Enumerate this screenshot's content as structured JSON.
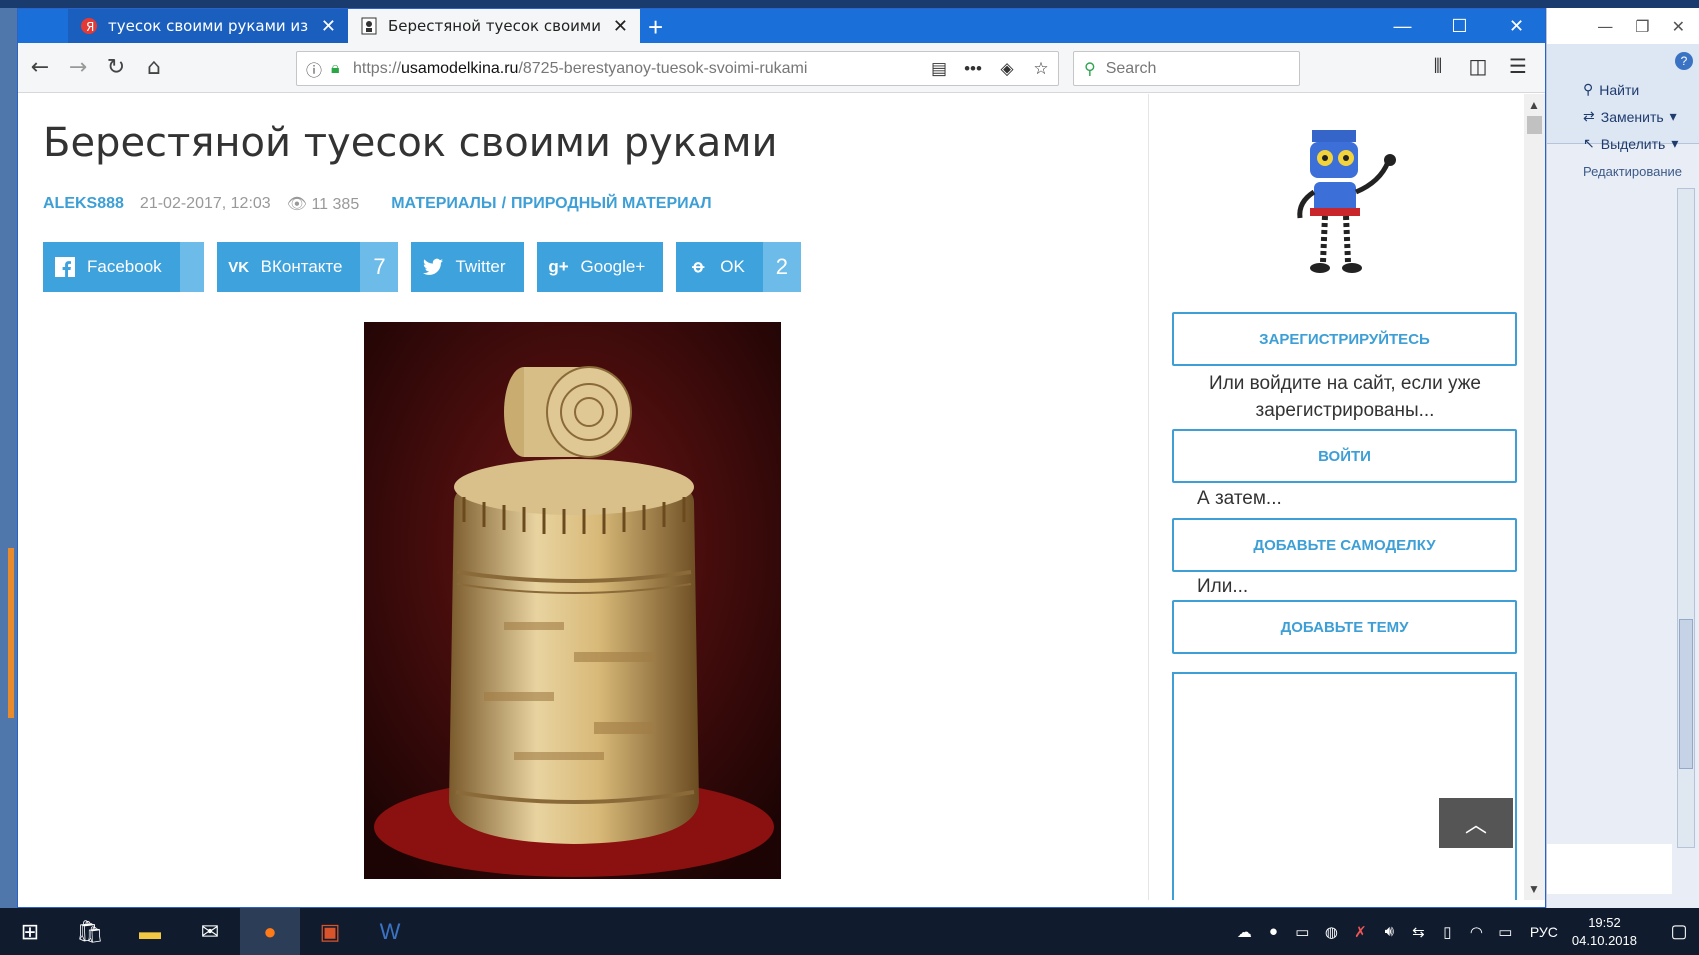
{
  "browser": {
    "tabs": [
      {
        "title": "туесок своими руками из бер",
        "state": "inactive"
      },
      {
        "title": "Берестяной туесок своими ру",
        "state": "active"
      }
    ],
    "url": {
      "prefix": "https://",
      "domain": "usamodelkina.ru",
      "path": "/8725-berestyanoy-tuesok-svoimi-rukami"
    },
    "search_placeholder": "Search"
  },
  "article": {
    "title": "Берестяной туесок своими руками",
    "author": "ALEKS888",
    "date": "21-02-2017, 12:03",
    "views": "11 385",
    "category1": "МАТЕРИАЛЫ",
    "category_sep": "/",
    "category2": "ПРИРОДНЫЙ МАТЕРИАЛ",
    "share": [
      {
        "label": "Facebook",
        "count": "",
        "icon": "facebook-icon"
      },
      {
        "label": "ВКонтакте",
        "count": "7",
        "icon": "vk-icon"
      },
      {
        "label": "Twitter",
        "count": "",
        "icon": "twitter-icon"
      },
      {
        "label": "Google+",
        "count": "",
        "icon": "googleplus-icon"
      },
      {
        "label": "OK",
        "count": "2",
        "icon": "ok-icon"
      }
    ]
  },
  "sidebar": {
    "register": "ЗАРЕГИСТРИРУЙТЕСЬ",
    "or_login_text": "Или войдите на сайт, если уже зарегистрированы...",
    "login": "ВОЙТИ",
    "then_text": "А затем...",
    "add_craft": "ДОБАВЬТЕ САМОДЕЛКУ",
    "or_text": "Или...",
    "add_topic": "ДОБАВЬТЕ ТЕМУ"
  },
  "word": {
    "find": "Найти",
    "replace": "Заменить",
    "select": "Выделить",
    "group": "Редактирование"
  },
  "taskbar": {
    "lang": "РУС",
    "time": "19:52",
    "date": "04.10.2018"
  },
  "colors": {
    "accent": "#3d9fd6",
    "share_bg": "#3ea2dd",
    "tabbar": "#1b6fd9"
  }
}
